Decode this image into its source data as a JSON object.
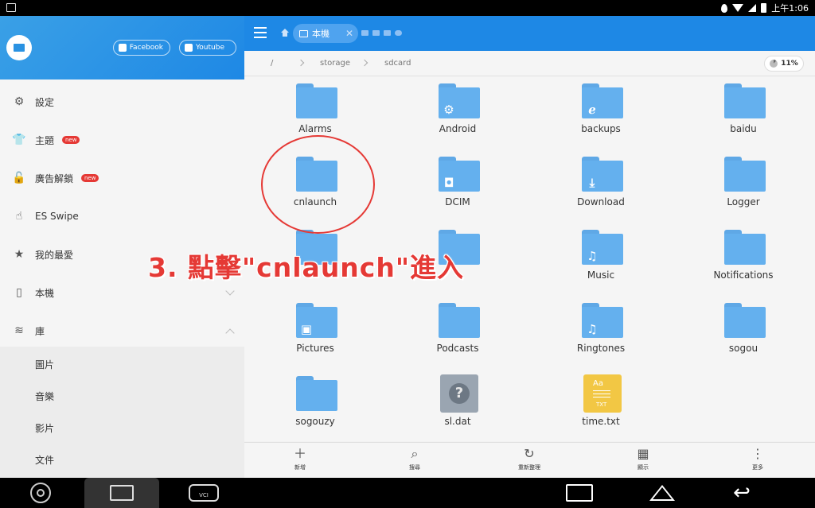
{
  "status_bar": {
    "time": "上午1:06",
    "icons": [
      "location-icon",
      "wifi-icon",
      "signal-icon",
      "battery-icon"
    ]
  },
  "drawer": {
    "header": {
      "facebook_label": "Facebook",
      "youtube_label": "Youtube"
    },
    "items": [
      {
        "label": "設定",
        "icon": "gear-icon"
      },
      {
        "label": "主題",
        "icon": "shirt-icon",
        "badge": "new"
      },
      {
        "label": "廣告解鎖",
        "icon": "lock-icon",
        "badge": "new"
      },
      {
        "label": "ES Swipe",
        "icon": "swipe-hand-icon"
      },
      {
        "label": "我的最愛",
        "icon": "star-icon"
      },
      {
        "label": "本機",
        "icon": "phone-icon"
      },
      {
        "label": "庫",
        "icon": "layers-icon"
      }
    ],
    "library_items": [
      "圖片",
      "音樂",
      "影片",
      "文件"
    ]
  },
  "toolbar": {
    "tab_label": "本機"
  },
  "path": {
    "segments": [
      "/",
      "storage",
      "sdcard"
    ],
    "usage": "11%"
  },
  "files": [
    {
      "name": "Alarms",
      "type": "folder",
      "emblem": ""
    },
    {
      "name": "Android",
      "type": "folder",
      "emblem": "gear"
    },
    {
      "name": "backups",
      "type": "folder",
      "emblem": "es"
    },
    {
      "name": "baidu",
      "type": "folder",
      "emblem": ""
    },
    {
      "name": "cnlaunch",
      "type": "folder",
      "emblem": ""
    },
    {
      "name": "DCIM",
      "type": "folder",
      "emblem": "camera"
    },
    {
      "name": "Download",
      "type": "folder",
      "emblem": "download"
    },
    {
      "name": "Logger",
      "type": "folder",
      "emblem": ""
    },
    {
      "name": "",
      "type": "folder",
      "emblem": ""
    },
    {
      "name": "",
      "type": "folder",
      "emblem": ""
    },
    {
      "name": "Music",
      "type": "folder",
      "emblem": "music"
    },
    {
      "name": "Notifications",
      "type": "folder",
      "emblem": ""
    },
    {
      "name": "Pictures",
      "type": "folder",
      "emblem": "image"
    },
    {
      "name": "Podcasts",
      "type": "folder",
      "emblem": ""
    },
    {
      "name": "Ringtones",
      "type": "folder",
      "emblem": "music"
    },
    {
      "name": "sogou",
      "type": "folder",
      "emblem": ""
    },
    {
      "name": "sogouzy",
      "type": "folder",
      "emblem": ""
    },
    {
      "name": "sl.dat",
      "type": "unknown-file",
      "emblem": "?"
    },
    {
      "name": "time.txt",
      "type": "text-file",
      "emblem": "TXT"
    }
  ],
  "bottom_bar": [
    {
      "label": "新增",
      "icon": "plus-icon"
    },
    {
      "label": "搜尋",
      "icon": "search-icon"
    },
    {
      "label": "重新整理",
      "icon": "refresh-icon"
    },
    {
      "label": "顯示",
      "icon": "grid-view-icon"
    },
    {
      "label": "更多",
      "icon": "more-vert-icon"
    }
  ],
  "annotation": {
    "text": "3. 點擊\"cnlaunch\"進入"
  },
  "nav_bar": {
    "vci_label": "VCI"
  },
  "colors": {
    "accent": "#1e88e5",
    "folder": "#64b0ee",
    "annotation": "#e53935"
  }
}
